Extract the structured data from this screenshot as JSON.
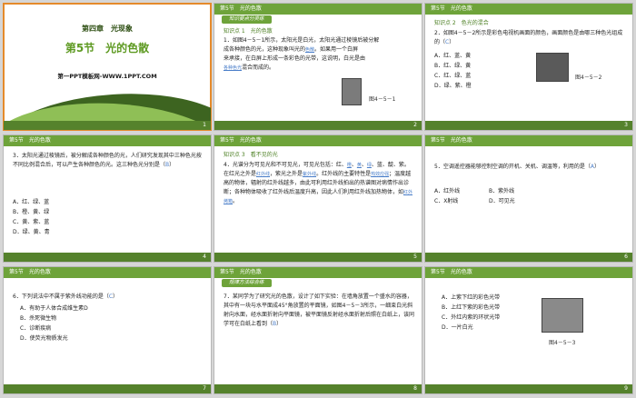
{
  "slides": [
    {
      "id": 1,
      "number": "1",
      "chapter": "第四章　光现象",
      "title": "第5节　光的色散",
      "site": "第一PPT模板网-WWW.1PPT.COM"
    },
    {
      "id": 2,
      "number": "2",
      "section": "第5节　光的色散",
      "banner": "知识要点分类练",
      "kp": "知识点 1　光的色散",
      "lines": [
        "1．如图4－5－1所示，太阳光是白光，太阳光通过棱镜后被分解",
        "成各种颜色的光，这种现象叫光的",
        "。如果用一个白屏",
        "来承接，在白屏上形成一条彩色的光带，这说明，白光是由",
        "混合而成的。"
      ],
      "blanks": [
        "色散",
        "各种色光"
      ],
      "figcap": "图4－5－1"
    },
    {
      "id": 3,
      "number": "3",
      "section": "第5节　光的色散",
      "kp": "知识点 2　色光的混合",
      "q": "2．如图4－5－2所示是彩色电视机画面的颜色，画面颜色是由哪三种色光组成的（",
      "answer": "C",
      "q_end": "）",
      "options": [
        "A．红、蓝、黄",
        "B．红、绿、黄",
        "C．红、绿、蓝",
        "D．绿、紫、橙"
      ],
      "figcap": "图4－5－2"
    },
    {
      "id": 4,
      "number": "4",
      "section": "第5节　光的色散",
      "q": "3．太阳光通过棱镜后，被分解成各种颜色的光，人们研究发现其中三种色光按不同比例混合后，可以产生各种颜色的光。这三种色光分别是（",
      "answer": "B",
      "q_end": "）",
      "options": [
        "A．红、绿、蓝",
        "B．橙、黄、绿",
        "C．黄、紫、蓝",
        "D．绿、黄、青"
      ]
    },
    {
      "id": 5,
      "number": "5",
      "section": "第5节　光的色散",
      "kp": "知识点 3　看不见的光",
      "lines": [
        "4．光谱分为可见光和不可见光，可见光包括：红、",
        "、",
        "、蓝、靛、紫。在红光之外是",
        "，紫光之外是",
        "。红外线的主要特性是",
        "；温度越高的物体，辐射的红外线越多，由此可利用红外线拍出的热谱图对病情作出诊断；各种物体吸收了红外线后温度升高，因此人们利用红外线加热物体，如",
        "。"
      ],
      "blanks": [
        "橙",
        "黄",
        "绿",
        "红外线",
        "紫外线",
        "热效应强",
        "红外烤箱"
      ]
    },
    {
      "id": 6,
      "number": "6",
      "section": "第5节　光的色散",
      "q": "5．空调遥控器能够控制空调的开机、关机、调温等，利用的是（",
      "answer": "A",
      "q_end": "）",
      "options": [
        "A．红外线",
        "B．紫外线",
        "C．X射线",
        "D．可见光"
      ]
    },
    {
      "id": 7,
      "number": "7",
      "section": "第5节　光的色散",
      "q": "6．下列说法中不属于紫外线功能的是（",
      "answer": "C",
      "q_end": "）",
      "options": [
        "A．有助于人体合成维生素D",
        "B．杀死微生物",
        "C．诊断疾病",
        "D．使荧光物质发光"
      ]
    },
    {
      "id": 8,
      "number": "8",
      "section": "第5节　光的色散",
      "banner": "规律方法综合练",
      "q": "7．某同学为了研究光的色散，设计了如下实验：在墙角放置一个盛水的容器，其中有一块与水平面成45°角放置的平面镜，如图4－5－3所示，一细束白光斜射向水面，经水面折射向平面镜，被平面镜反射经水面折射后照在白纸上，该同学可在白纸上看到（",
      "answer": "B",
      "q_end": "）"
    },
    {
      "id": 9,
      "number": "9",
      "section": "第5节　光的色散",
      "options": [
        "A．上紫下红的彩色光带",
        "B．上红下紫的彩色光带",
        "C．外红内紫的环状光带",
        "D．一片白光"
      ],
      "figcap": "图4－5－3"
    }
  ],
  "colors": {
    "accent": "#6ea33a",
    "dark": "#3d6420",
    "answer": "#4a7ec9",
    "selection": "#e58a2b"
  }
}
